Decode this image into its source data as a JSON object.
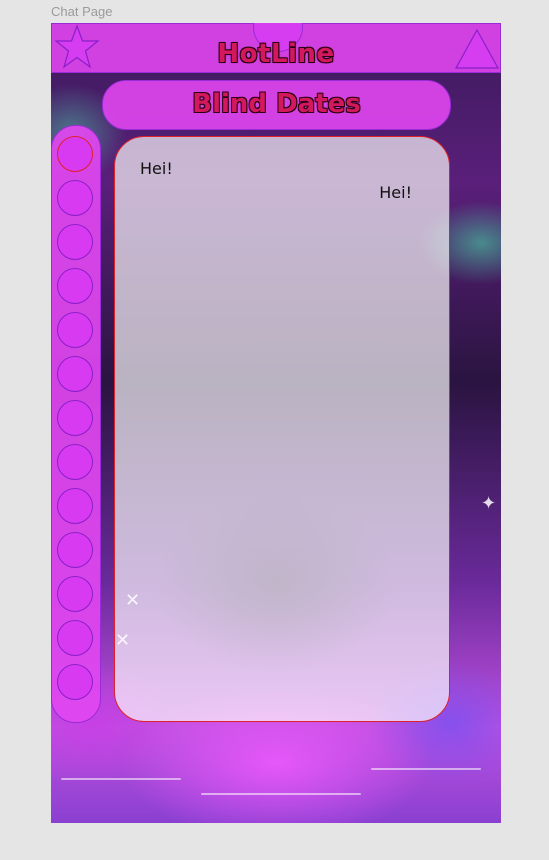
{
  "page_label": "Chat Page",
  "header": {
    "title": "HotLine",
    "left_icon": "star-icon",
    "right_icon": "triangle-icon"
  },
  "subheader": {
    "title": "Blind Dates"
  },
  "sidebar": {
    "contact_slots": 13,
    "active_index": 0
  },
  "chat": {
    "messages": [
      {
        "direction": "received",
        "text": "Hei!"
      },
      {
        "direction": "sent",
        "text": "Hei!"
      }
    ]
  },
  "colors": {
    "accent": "#e146f0",
    "border": "#9a2bd8",
    "title_text": "#d4185e",
    "active_outline": "#e0202a"
  }
}
